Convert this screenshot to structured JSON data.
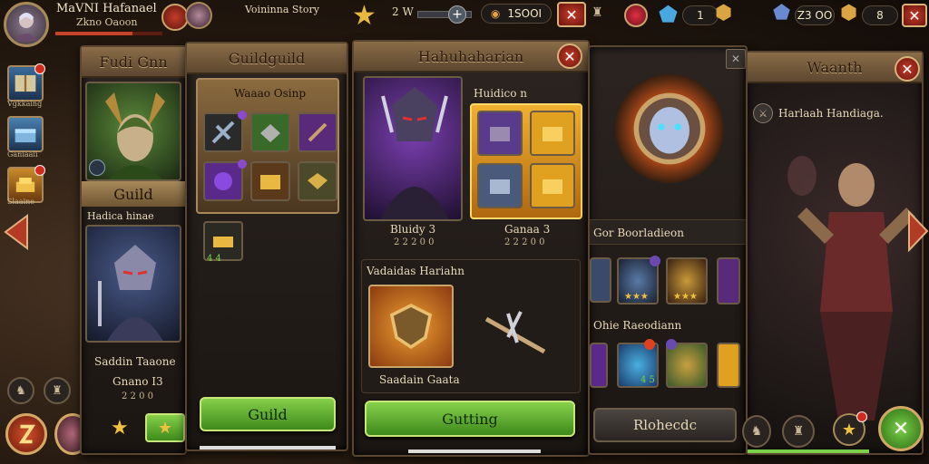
{
  "colors": {
    "gold": "#d9a441",
    "green": "#5bb132",
    "red": "#c43b2a",
    "purple": "#7a3fb0",
    "blue": "#4aa8e0"
  },
  "player": {
    "name": "MaVNI Hafanael",
    "sub": "Zkno Oaoon"
  },
  "top_bar": {
    "panel2_label": "Voininna Story",
    "gem_label": "2 W",
    "currency_value": "1SOOI",
    "res1_value": "1",
    "res2_value": "Z3 OO",
    "res3_value": "8"
  },
  "left_menu": {
    "btn1": "Vgkkaing",
    "btn2": "Ganiaaii",
    "btn3": "Slaaine"
  },
  "panel1": {
    "title": "Fudi Gnn",
    "guild_label": "Guild",
    "hero_label": "Hadica hinae",
    "hero_name": "Saddin Taaone",
    "hero_sub": "Gnano I3",
    "hero_sub2": "2 2 0 0"
  },
  "panel2": {
    "title": "Guildguild",
    "section_title": "Waaao Osinp",
    "small_item_label": "4 4",
    "button": "Guild"
  },
  "panel3": {
    "title": "Hahuhaharian",
    "heading": "Huidico n",
    "hero_label": "Bluidy 3",
    "hero_sub": "2 2 2 0 0",
    "chest_label": "Ganaa 3",
    "chest_sub": "2 2 2 0 0",
    "reward_title": "Vadaidas Hariahn",
    "reward_label": "Saadain Gaata",
    "button": "Gutting"
  },
  "panel4": {
    "section1": "Gor Boorladieon",
    "section2": "Ohie Raeodiann",
    "stars_label": "★★★",
    "slot_count": "4 5",
    "button": "Rlohecdc"
  },
  "panel5": {
    "title": "Waanth",
    "subtitle": "Harlaah Handiaga."
  }
}
